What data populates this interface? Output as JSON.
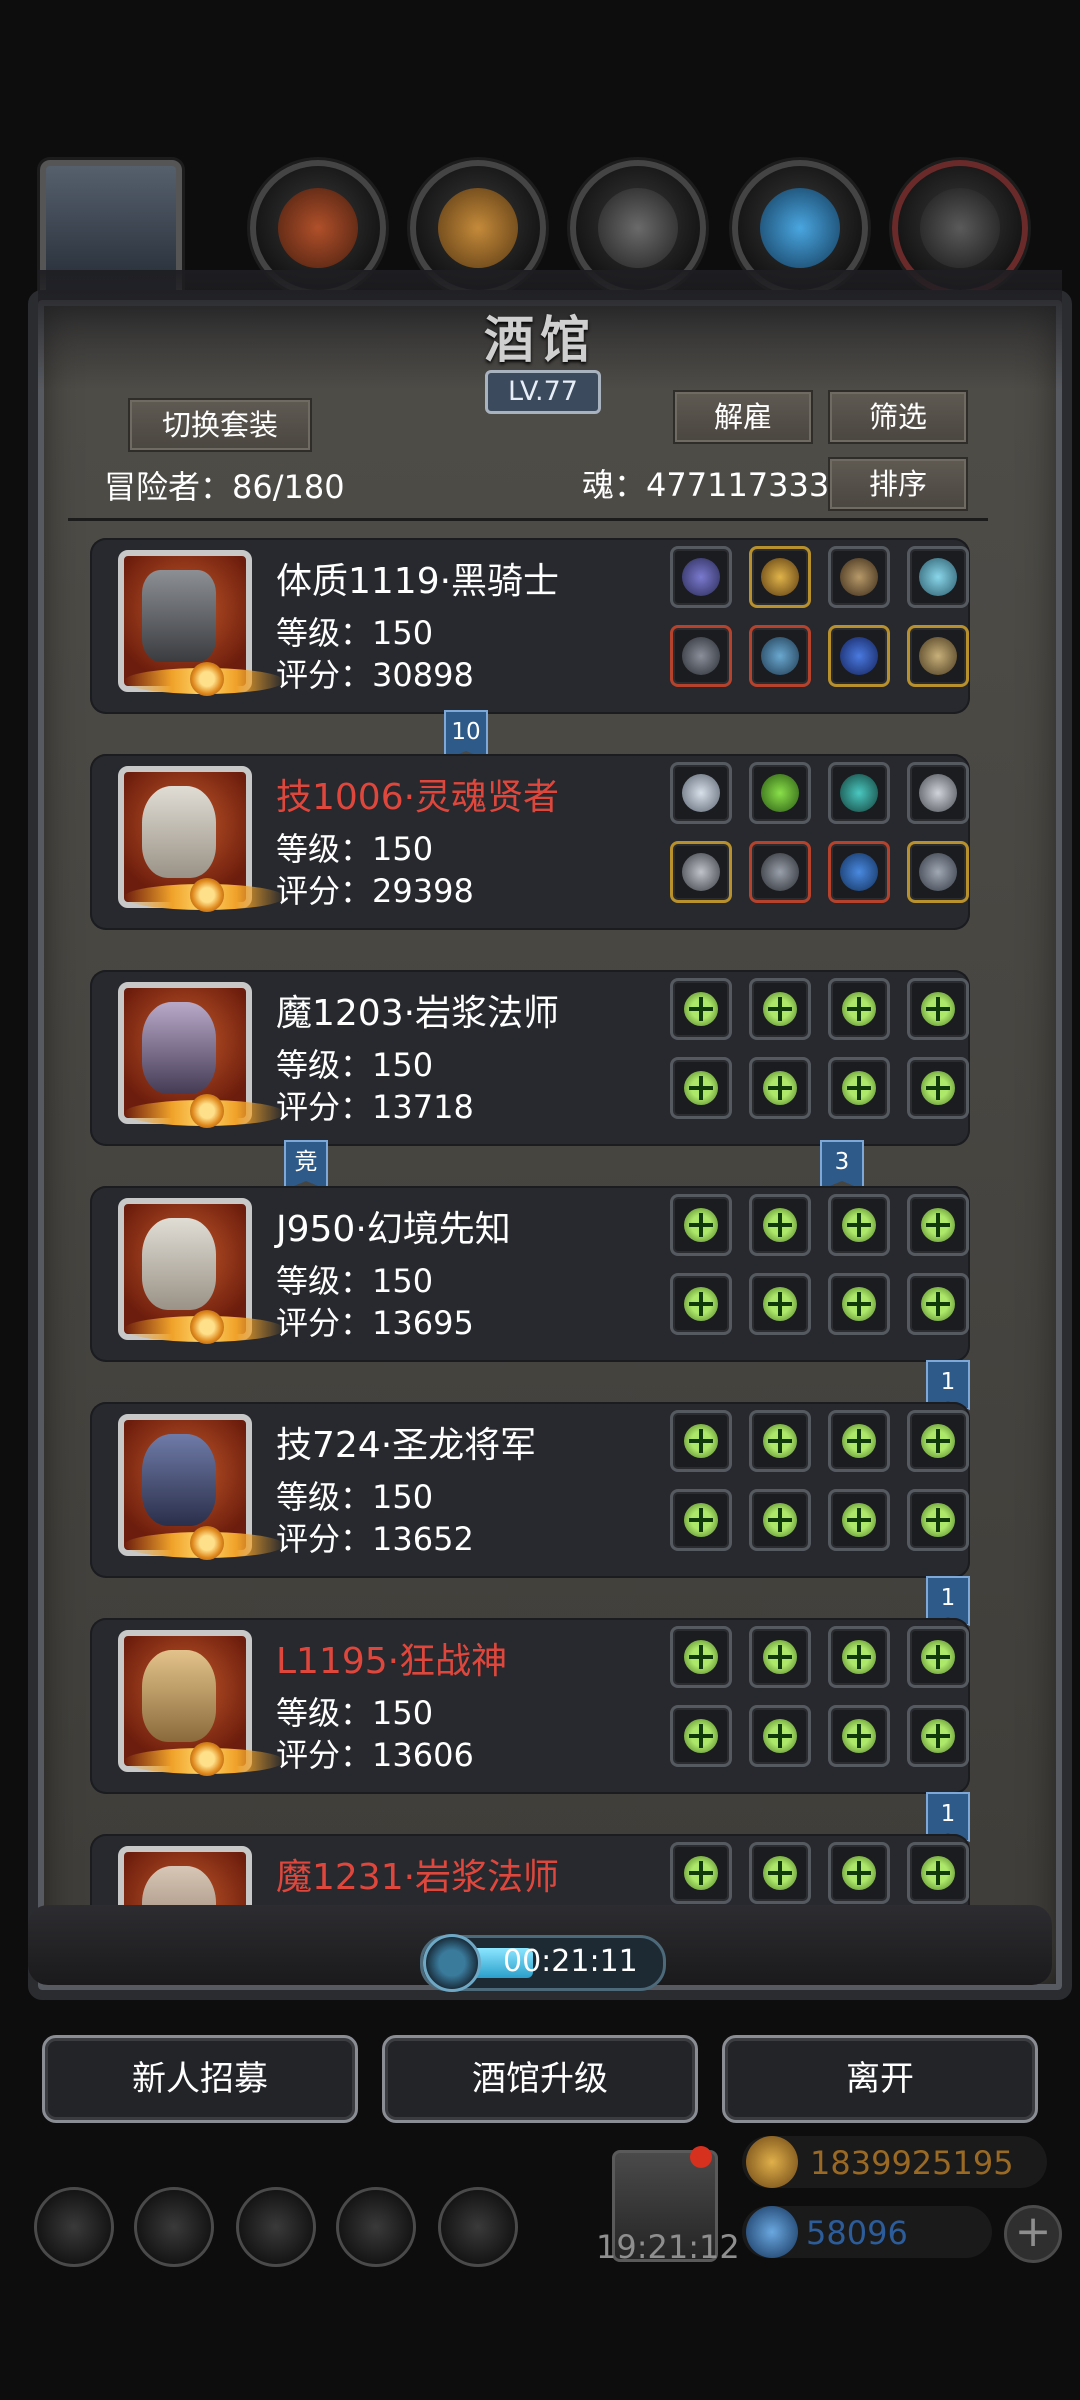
{
  "tavern": {
    "title": "酒馆",
    "level": "LV.77",
    "switch_outfit_label": "切换套装",
    "dismiss_label": "解雇",
    "filter_label": "筛选",
    "sort_label": "排序",
    "adventurers_label": "冒险者：86/180",
    "soul_label": "魂：477117333"
  },
  "heroes": [
    {
      "name": "体质1119·黑骑士",
      "name_color": "white",
      "level": "等级：150",
      "score": "评分：30898",
      "equipped": true
    },
    {
      "name": "技1006·灵魂贤者",
      "name_color": "red",
      "level": "等级：150",
      "score": "评分：29398",
      "equipped": true
    },
    {
      "name": "魔1203·岩浆法师",
      "name_color": "white",
      "level": "等级：150",
      "score": "评分：13718",
      "equipped": false
    },
    {
      "name": "J950·幻境先知",
      "name_color": "white",
      "level": "等级：150",
      "score": "评分：13695",
      "equipped": false
    },
    {
      "name": "技724·圣龙将军",
      "name_color": "white",
      "level": "等级：150",
      "score": "评分：13652",
      "equipped": false
    },
    {
      "name": "L1195·狂战神",
      "name_color": "red",
      "level": "等级：150",
      "score": "评分：13606",
      "equipped": false
    },
    {
      "name": "魔1231·岩浆法师",
      "name_color": "red",
      "level": "",
      "score": "",
      "equipped": false
    }
  ],
  "ribbons": [
    "10",
    "竞",
    "3",
    "1",
    "1",
    "1"
  ],
  "timer": "00:21:11",
  "actions": {
    "recruit_label": "新人招募",
    "upgrade_label": "酒馆升级",
    "leave_label": "离开"
  },
  "footer": {
    "clock": "19:21:12",
    "gold": "1839925195",
    "gems": "58096",
    "add_symbol": "+"
  },
  "colors": {
    "accent_red": "#e0473c",
    "gold_text": "#9a6a24",
    "gem_text": "#2d5c9a",
    "plus_green": "#aee86a"
  },
  "icons": [
    "hero-avatar-icon",
    "helmet-icon",
    "armor-icon",
    "gloves-icon",
    "crystal-icon",
    "boots-icon",
    "settings-icon",
    "star-icon",
    "rune-icon",
    "mail-icon",
    "shield-icon",
    "gift-icon",
    "gold-coin-icon",
    "gem-icon",
    "plus-icon",
    "timer-icon"
  ]
}
